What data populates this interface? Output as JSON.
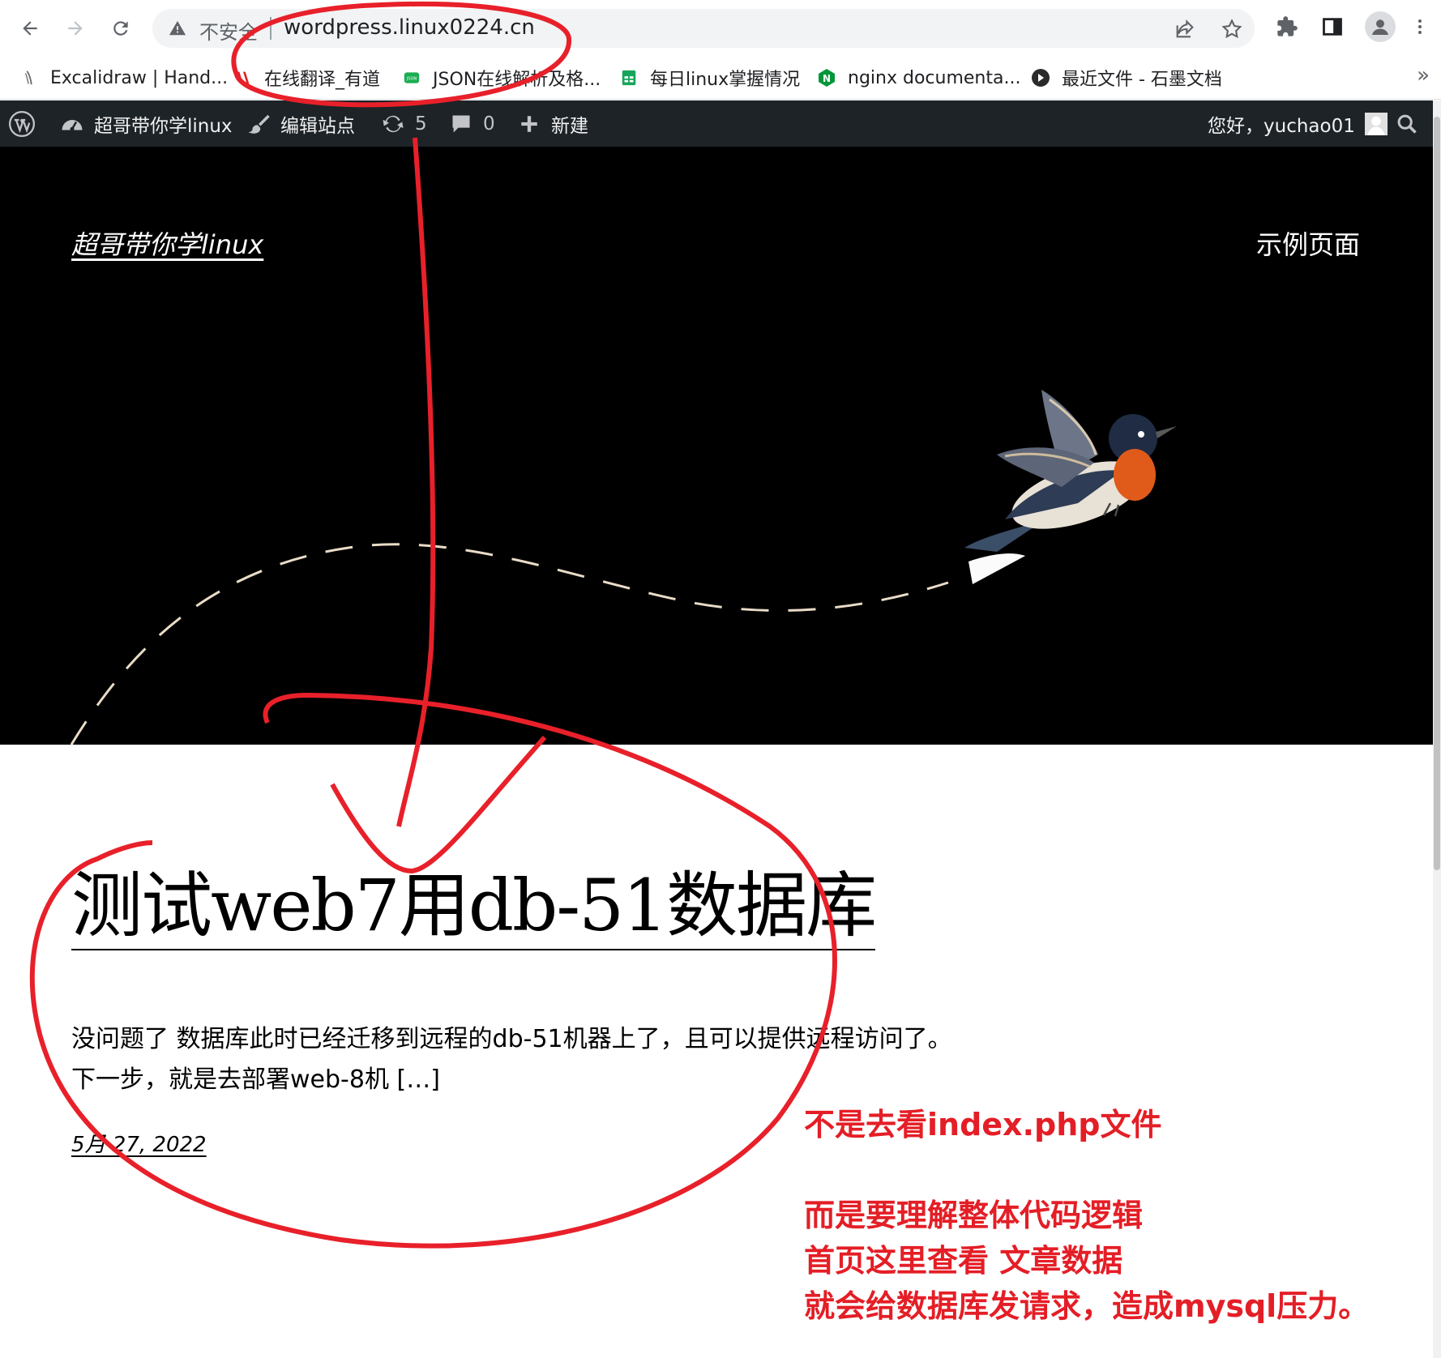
{
  "browser": {
    "security_label": "不安全",
    "url": "wordpress.linux0224.cn",
    "icons": [
      "back-icon",
      "forward-icon",
      "reload-icon",
      "warning-icon",
      "share-icon",
      "star-icon",
      "extensions-icon",
      "side-panel-icon",
      "profile-icon",
      "menu-icon"
    ]
  },
  "bookmarks": [
    {
      "label": "Excalidraw | Hand...",
      "icon": "excalidraw-icon"
    },
    {
      "label": "在线翻译_有道",
      "icon": "youdao-icon"
    },
    {
      "label": "JSON在线解析及格...",
      "icon": "json-icon"
    },
    {
      "label": "每日linux掌握情况",
      "icon": "sheet-icon"
    },
    {
      "label": "nginx documenta...",
      "icon": "nginx-icon"
    },
    {
      "label": "最近文件 - 石墨文档",
      "icon": "shimo-icon"
    }
  ],
  "bookmarks_more": "»",
  "adminbar": {
    "site_name": "超哥带你学linux",
    "edit_site": "编辑站点",
    "updates_count": "5",
    "comments_count": "0",
    "new_label": "新建",
    "greeting": "您好，yuchao01"
  },
  "header": {
    "site_title": "超哥带你学linux",
    "nav_item": "示例页面"
  },
  "post": {
    "title": "测试web7用db-51数据库",
    "excerpt_line1": "没问题了 数据库此时已经迁移到远程的db-51机器上了，且可以提供远程访问了。",
    "excerpt_line2": "下一步，就是去部署web-8机 […]",
    "date": "5月 27, 2022"
  },
  "annotation": {
    "line1": "不是去看index.php文件",
    "line2": "而是要理解整体代码逻辑",
    "line3": "首页这里查看 文章数据",
    "line4": "就会给数据库发请求，造成mysql压力。"
  },
  "colors": {
    "adminbar_bg": "#1d2327",
    "hero_bg": "#000000",
    "annotation_red": "#e41e26",
    "marker_red": "#e8202a"
  }
}
